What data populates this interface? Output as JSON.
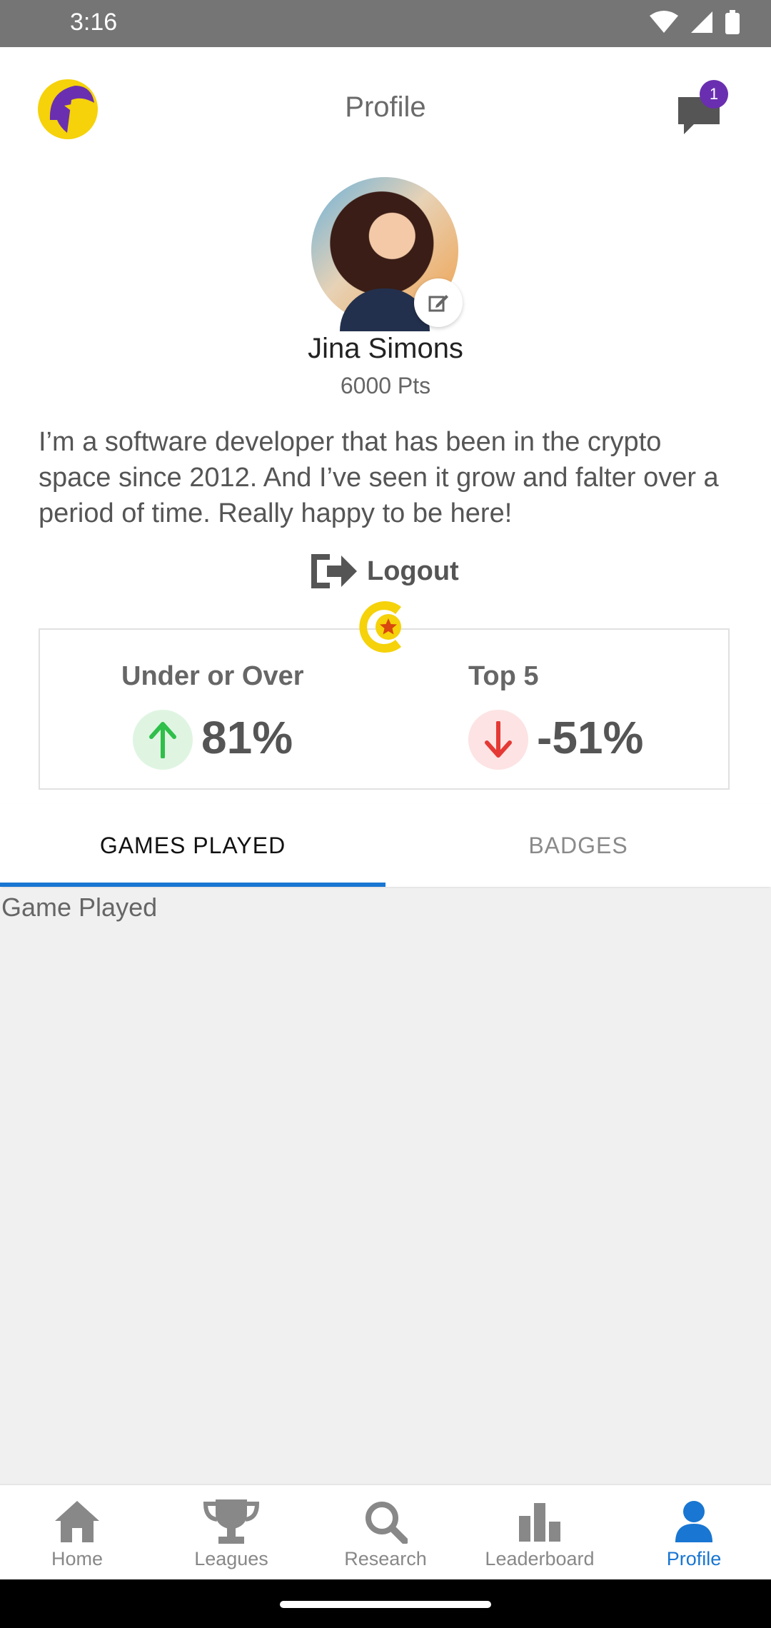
{
  "status": {
    "time": "3:16"
  },
  "header": {
    "title": "Profile",
    "notification_count": "1"
  },
  "profile": {
    "name": "Jina Simons",
    "points": "6000 Pts",
    "bio": "I’m a software developer that has been in the crypto space since 2012. And I’ve seen it grow and falter over a period of time. Really happy to be here!",
    "logout_label": "Logout"
  },
  "stats": [
    {
      "title": "Under or Over",
      "value": "81%",
      "direction": "up",
      "color": "#2fbf4a"
    },
    {
      "title": "Top 5",
      "value": "-51%",
      "direction": "down",
      "color": "#e53935"
    }
  ],
  "tabs": [
    {
      "label": "GAMES PLAYED",
      "active": true
    },
    {
      "label": "BADGES",
      "active": false
    }
  ],
  "content": {
    "label": "Game Played"
  },
  "bottom_nav": [
    {
      "label": "Home",
      "icon": "home-icon",
      "active": false
    },
    {
      "label": "Leagues",
      "icon": "trophy-icon",
      "active": false
    },
    {
      "label": "Research",
      "icon": "search-icon",
      "active": false
    },
    {
      "label": "Leaderboard",
      "icon": "bar-chart-icon",
      "active": false
    },
    {
      "label": "Profile",
      "icon": "person-icon",
      "active": true
    }
  ],
  "colors": {
    "accent": "#1976d2",
    "brand_purple": "#6a2fb0",
    "brand_yellow": "#f5d20a"
  }
}
